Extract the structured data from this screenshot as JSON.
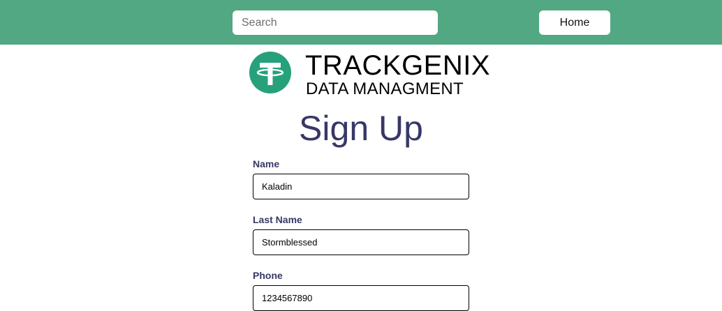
{
  "header": {
    "search_placeholder": "Search",
    "home_label": "Home",
    "background_color": "#51a882"
  },
  "brand": {
    "logo_icon": "tether-t-logo-icon",
    "logo_color": "#26a17b",
    "name": "TRACKGENIX",
    "subtitle": "DATA MANAGMENT"
  },
  "form": {
    "title": "Sign Up",
    "title_color": "#373866",
    "fields": [
      {
        "label": "Name",
        "value": "Kaladin"
      },
      {
        "label": "Last Name",
        "value": "Stormblessed"
      },
      {
        "label": "Phone",
        "value": "1234567890"
      }
    ]
  }
}
